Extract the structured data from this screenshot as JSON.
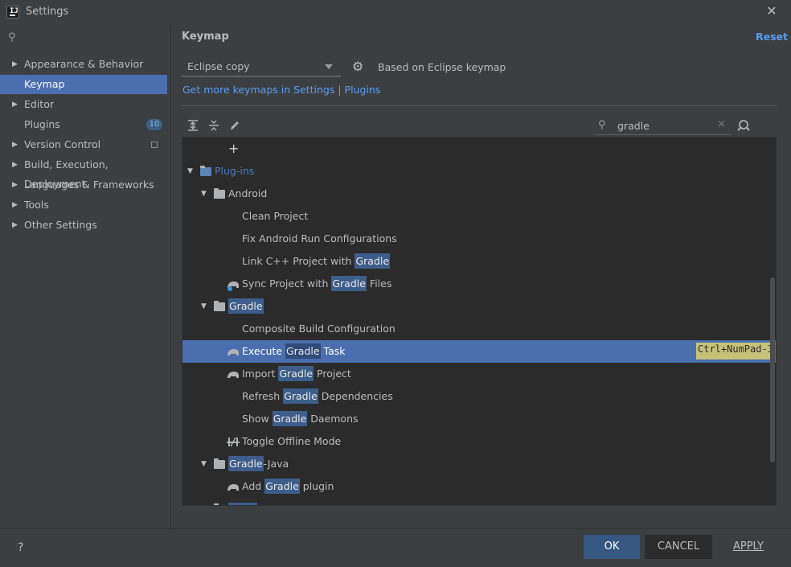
{
  "window": {
    "title": "Settings"
  },
  "sidebar": {
    "items": [
      {
        "label": "Appearance & Behavior",
        "expandable": true
      },
      {
        "label": "Keymap",
        "selected": true
      },
      {
        "label": "Editor",
        "expandable": true
      },
      {
        "label": "Plugins",
        "badge": "10"
      },
      {
        "label": "Version Control",
        "expandable": true
      },
      {
        "label": "Build, Execution, Deployment",
        "expandable": true
      },
      {
        "label": "Languages & Frameworks",
        "expandable": true
      },
      {
        "label": "Tools",
        "expandable": true
      },
      {
        "label": "Other Settings",
        "expandable": true
      }
    ]
  },
  "main": {
    "title": "Keymap",
    "reset_label": "Reset",
    "keymap_value": "Eclipse copy",
    "based_on": "Based on Eclipse keymap",
    "plugins_link": "Get more keymaps in Settings | Plugins",
    "search_value": "gradle",
    "search_clear": "×"
  },
  "tree": {
    "plus": "+",
    "rows": [
      {
        "pre": "Plug-ins",
        "hl": "",
        "post": ""
      },
      {
        "pre": "Android",
        "hl": "",
        "post": ""
      },
      {
        "pre": "Clean Project",
        "hl": "",
        "post": ""
      },
      {
        "pre": "Fix Android Run Configurations",
        "hl": "",
        "post": ""
      },
      {
        "pre": "Link C++ Project with ",
        "hl": "Gradle",
        "post": ""
      },
      {
        "pre": "Sync Project with ",
        "hl": "Gradle",
        "post": " Files"
      },
      {
        "pre": "",
        "hl": "Gradle",
        "post": ""
      },
      {
        "pre": "Composite Build Configuration",
        "hl": "",
        "post": ""
      },
      {
        "pre": "Execute ",
        "hl": "Gradle",
        "post": " Task",
        "shortcut": "Ctrl+NumPad-3"
      },
      {
        "pre": "Import ",
        "hl": "Gradle",
        "post": " Project"
      },
      {
        "pre": "Refresh ",
        "hl": "Gradle",
        "post": " Dependencies"
      },
      {
        "pre": "Show ",
        "hl": "Gradle",
        "post": " Daemons"
      },
      {
        "pre": "Toggle Offline Mode",
        "hl": "",
        "post": ""
      },
      {
        "pre": "",
        "hl": "Gradle",
        "post": "-Java"
      },
      {
        "pre": "Add ",
        "hl": "Gradle",
        "post": " plugin"
      }
    ]
  },
  "footer": {
    "help": "?",
    "ok": "OK",
    "cancel": "CANCEL",
    "apply": "APPLY"
  },
  "colors": {
    "accent": "#4b6eaf",
    "link": "#589df6",
    "highlight": "#3d5d8a",
    "shortcut_bg": "#c7c27a"
  }
}
